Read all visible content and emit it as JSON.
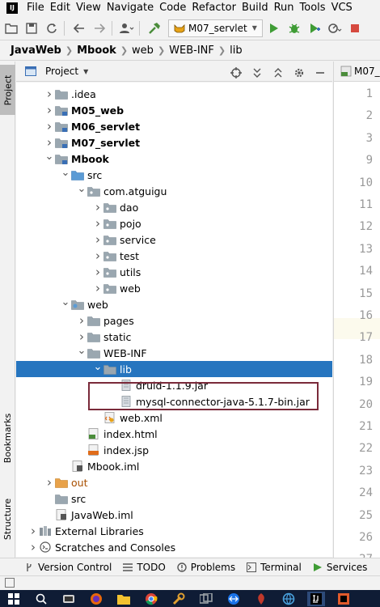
{
  "menu": {
    "items": [
      "File",
      "Edit",
      "View",
      "Navigate",
      "Code",
      "Refactor",
      "Build",
      "Run",
      "Tools",
      "VCS"
    ],
    "app_logo": "IJ"
  },
  "toolbar": {
    "run_config": "M07_servlet",
    "buttons": [
      "open-icon",
      "save-icon",
      "sync-icon",
      "back-icon",
      "forward-icon",
      "user-icon",
      "build-hammer-icon",
      "run-icon",
      "debug-icon",
      "coverage-icon",
      "profile-icon"
    ]
  },
  "breadcrumb": {
    "items": [
      "JavaWeb",
      "Mbook",
      "web",
      "WEB-INF",
      "lib"
    ],
    "bold": [
      true,
      true,
      false,
      false,
      false
    ]
  },
  "side": {
    "project_tab": "Project",
    "bookmarks_tab": "Bookmarks",
    "structure_tab": "Structure"
  },
  "panel": {
    "title": "Project"
  },
  "tree": {
    "rows": [
      {
        "label": ".idea",
        "depth": 1,
        "arrow": "right",
        "icon": "folder",
        "bold": false
      },
      {
        "label": "M05_web",
        "depth": 1,
        "arrow": "right",
        "icon": "module",
        "bold": true
      },
      {
        "label": "M06_servlet",
        "depth": 1,
        "arrow": "right",
        "icon": "module",
        "bold": true
      },
      {
        "label": "M07_servlet",
        "depth": 1,
        "arrow": "right",
        "icon": "module",
        "bold": true
      },
      {
        "label": "Mbook",
        "depth": 1,
        "arrow": "down",
        "icon": "module",
        "bold": true
      },
      {
        "label": "src",
        "depth": 2,
        "arrow": "down",
        "icon": "src",
        "bold": false
      },
      {
        "label": "com.atguigu",
        "depth": 3,
        "arrow": "down",
        "icon": "package",
        "bold": false
      },
      {
        "label": "dao",
        "depth": 4,
        "arrow": "right",
        "icon": "package",
        "bold": false
      },
      {
        "label": "pojo",
        "depth": 4,
        "arrow": "right",
        "icon": "package",
        "bold": false
      },
      {
        "label": "service",
        "depth": 4,
        "arrow": "right",
        "icon": "package",
        "bold": false
      },
      {
        "label": "test",
        "depth": 4,
        "arrow": "right",
        "icon": "package",
        "bold": false
      },
      {
        "label": "utils",
        "depth": 4,
        "arrow": "right",
        "icon": "package",
        "bold": false
      },
      {
        "label": "web",
        "depth": 4,
        "arrow": "right",
        "icon": "package",
        "bold": false
      },
      {
        "label": "web",
        "depth": 2,
        "arrow": "down",
        "icon": "webfolder",
        "bold": false
      },
      {
        "label": "pages",
        "depth": 3,
        "arrow": "right",
        "icon": "folder",
        "bold": false
      },
      {
        "label": "static",
        "depth": 3,
        "arrow": "right",
        "icon": "folder",
        "bold": false
      },
      {
        "label": "WEB-INF",
        "depth": 3,
        "arrow": "down",
        "icon": "folder",
        "bold": false
      },
      {
        "label": "lib",
        "depth": 4,
        "arrow": "down",
        "icon": "folder",
        "bold": false,
        "selected": true
      },
      {
        "label": "druid-1.1.9.jar",
        "depth": 5,
        "arrow": "none",
        "icon": "jar",
        "bold": false
      },
      {
        "label": "mysql-connector-java-5.1.7-bin.jar",
        "depth": 5,
        "arrow": "none",
        "icon": "jar",
        "bold": false
      },
      {
        "label": "web.xml",
        "depth": 4,
        "arrow": "none",
        "icon": "xml",
        "bold": false
      },
      {
        "label": "index.html",
        "depth": 3,
        "arrow": "none",
        "icon": "html",
        "bold": false
      },
      {
        "label": "index.jsp",
        "depth": 3,
        "arrow": "none",
        "icon": "jsp",
        "bold": false
      },
      {
        "label": "Mbook.iml",
        "depth": 2,
        "arrow": "none",
        "icon": "iml",
        "bold": false
      },
      {
        "label": "out",
        "depth": 1,
        "arrow": "right",
        "icon": "outfolder",
        "bold": false,
        "orange": true
      },
      {
        "label": "src",
        "depth": 1,
        "arrow": "none",
        "icon": "folder",
        "bold": false
      },
      {
        "label": "JavaWeb.iml",
        "depth": 1,
        "arrow": "none",
        "icon": "iml",
        "bold": false
      },
      {
        "label": "External Libraries",
        "depth": 0,
        "arrow": "right",
        "icon": "extlib",
        "bold": false
      },
      {
        "label": "Scratches and Consoles",
        "depth": 0,
        "arrow": "right",
        "icon": "scratch",
        "bold": false
      }
    ]
  },
  "editor": {
    "tab_label": "M07_",
    "line_numbers": [
      "1",
      "2",
      "3",
      "9",
      "10",
      "11",
      "12",
      "13",
      "14",
      "15",
      "16",
      "17",
      "18",
      "19",
      "20",
      "21",
      "22",
      "23",
      "24",
      "25",
      "26",
      "27",
      "28"
    ]
  },
  "bottom": {
    "tabs": [
      "Version Control",
      "TODO",
      "Problems",
      "Terminal",
      "Services"
    ]
  },
  "colors": {
    "selection": "#2675bf",
    "highlight_box": "#7a2a3a",
    "taskbar": "#0f1c35"
  }
}
